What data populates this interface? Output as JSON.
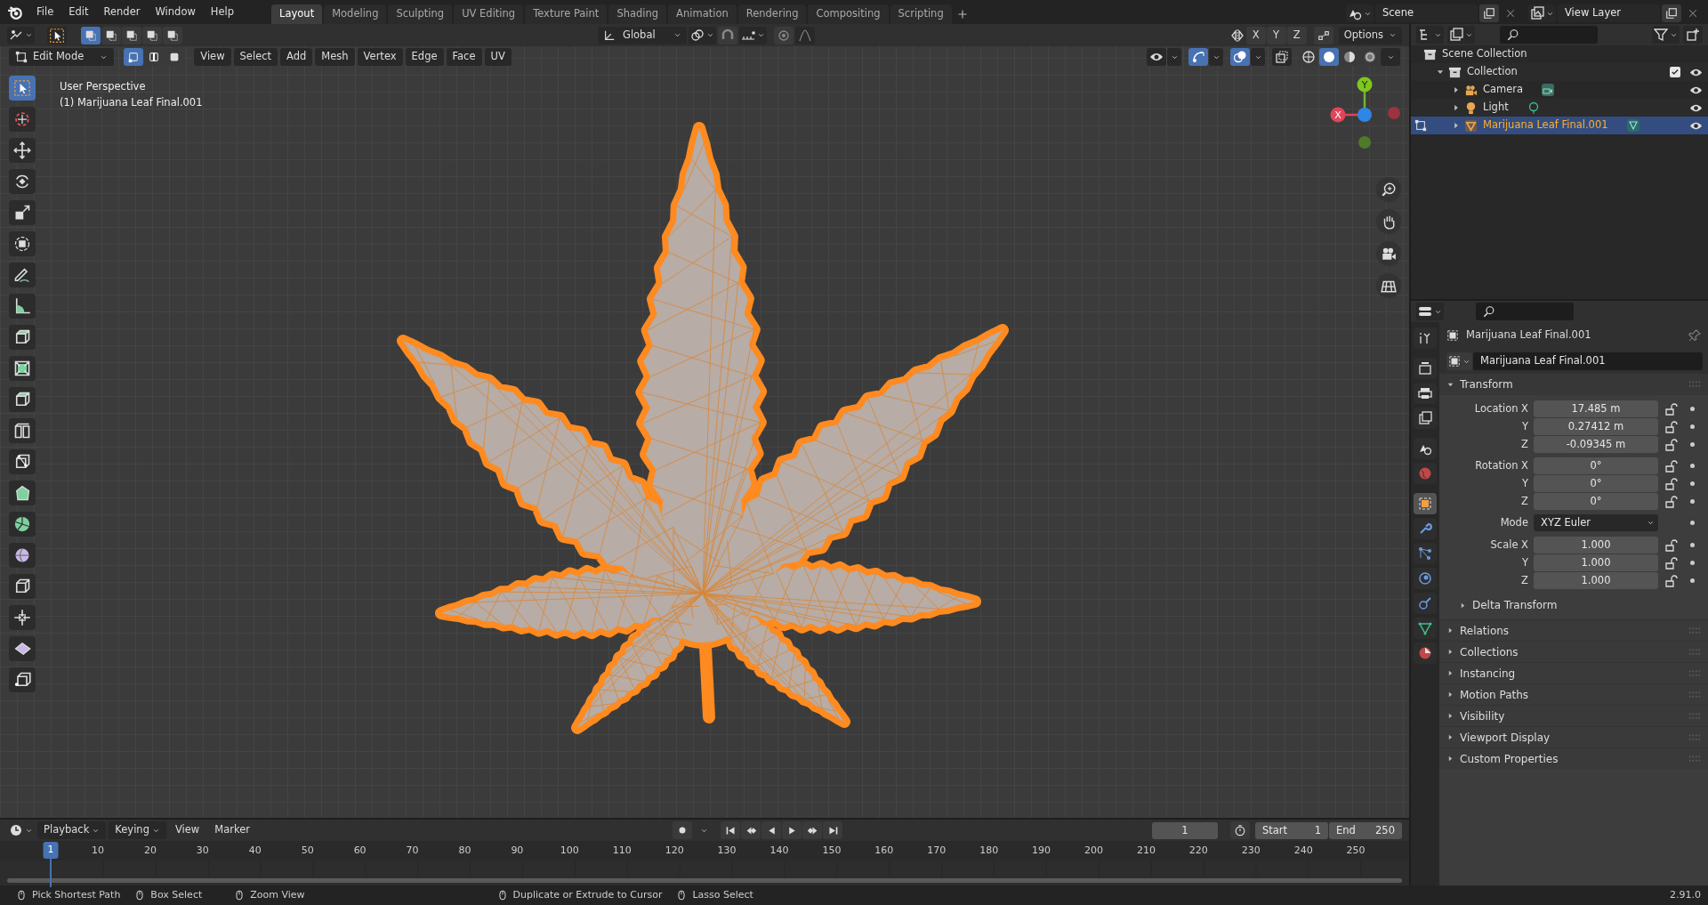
{
  "menu": [
    "File",
    "Edit",
    "Render",
    "Window",
    "Help"
  ],
  "workspaces": [
    {
      "label": "Layout",
      "selected": true
    },
    {
      "label": "Modeling",
      "selected": false
    },
    {
      "label": "Sculpting",
      "selected": false
    },
    {
      "label": "UV Editing",
      "selected": false
    },
    {
      "label": "Texture Paint",
      "selected": false
    },
    {
      "label": "Shading",
      "selected": false
    },
    {
      "label": "Animation",
      "selected": false
    },
    {
      "label": "Rendering",
      "selected": false
    },
    {
      "label": "Compositing",
      "selected": false
    },
    {
      "label": "Scripting",
      "selected": false
    }
  ],
  "scene": {
    "name": "Scene"
  },
  "view_layer": {
    "name": "View Layer"
  },
  "tool_header": {
    "orientation": "Global",
    "axes": [
      "X",
      "Y",
      "Z"
    ],
    "options": "Options"
  },
  "viewport_header": {
    "mode": "Edit Mode",
    "menus": [
      "View",
      "Select",
      "Add",
      "Mesh",
      "Vertex",
      "Edge",
      "Face",
      "UV"
    ]
  },
  "toolbar": [
    {
      "selected": true
    },
    {
      "selected": false
    },
    {
      "selected": false
    },
    {
      "selected": false
    },
    {
      "selected": false
    },
    {
      "selected": false
    },
    {
      "selected": false
    },
    {
      "selected": false
    },
    {
      "selected": false
    },
    {
      "selected": false
    },
    {
      "selected": false
    },
    {
      "selected": false
    },
    {
      "selected": false
    },
    {
      "selected": false
    },
    {
      "selected": false
    },
    {
      "selected": false
    },
    {
      "selected": false
    },
    {
      "selected": false
    },
    {
      "selected": false
    },
    {
      "selected": false
    }
  ],
  "viewport": {
    "view_name": "User Perspective",
    "object_label": "(1) Marijuana Leaf Final.001",
    "gizmo_labels": [
      "X",
      "Y"
    ]
  },
  "outliner": {
    "items": [
      {
        "label": "Scene Collection",
        "kind": "scene",
        "selected": false,
        "children": [
          {
            "label": "Collection",
            "kind": "collection",
            "selected": false,
            "expanded": true,
            "checked": true,
            "children": [
              {
                "label": "Camera",
                "kind": "camera",
                "selected": false,
                "expanded": false
              },
              {
                "label": "Light",
                "kind": "light",
                "selected": false,
                "expanded": false
              },
              {
                "label": "Marijuana Leaf Final.001",
                "kind": "mesh",
                "selected": true,
                "expanded": false
              }
            ]
          }
        ]
      }
    ]
  },
  "properties": {
    "tabs": [
      {
        "selected": false
      },
      {
        "selected": false
      },
      {
        "selected": false
      },
      {
        "selected": false
      },
      {
        "selected": false
      },
      {
        "selected": false
      },
      {
        "selected": true
      },
      {
        "selected": false
      },
      {
        "selected": false
      },
      {
        "selected": false
      },
      {
        "selected": false
      },
      {
        "selected": false
      },
      {
        "selected": false
      }
    ],
    "object_name": "Marijuana Leaf Final.001",
    "data_name": "Marijuana Leaf Final.001",
    "transform": {
      "title": "Transform",
      "expanded": true,
      "location": [
        {
          "label": "Location X",
          "value": "17.485 m"
        },
        {
          "label": "Y",
          "value": "0.27412 m"
        },
        {
          "label": "Z",
          "value": "-0.09345 m"
        }
      ],
      "rotation": [
        {
          "label": "Rotation X",
          "value": "0°"
        },
        {
          "label": "Y",
          "value": "0°"
        },
        {
          "label": "Z",
          "value": "0°"
        }
      ],
      "mode_label": "Mode",
      "mode": "XYZ Euler",
      "scale": [
        {
          "label": "Scale X",
          "value": "1.000"
        },
        {
          "label": "Y",
          "value": "1.000"
        },
        {
          "label": "Z",
          "value": "1.000"
        }
      ]
    },
    "delta_transform": {
      "title": "Delta Transform",
      "expanded": false
    },
    "panels": [
      {
        "title": "Relations",
        "expanded": false
      },
      {
        "title": "Collections",
        "expanded": false
      },
      {
        "title": "Instancing",
        "expanded": false
      },
      {
        "title": "Motion Paths",
        "expanded": false
      },
      {
        "title": "Visibility",
        "expanded": false
      },
      {
        "title": "Viewport Display",
        "expanded": false
      },
      {
        "title": "Custom Properties",
        "expanded": false
      }
    ]
  },
  "timeline": {
    "menus": [
      {
        "label": "Playback",
        "dropdown": true
      },
      {
        "label": "Keying",
        "dropdown": true
      },
      {
        "label": "View",
        "dropdown": false
      },
      {
        "label": "Marker",
        "dropdown": false
      }
    ],
    "current_frame": "1",
    "start_label": "Start",
    "start": "1",
    "end_label": "End",
    "end": "250",
    "playhead": "1",
    "ticks": [
      "10",
      "20",
      "30",
      "40",
      "50",
      "60",
      "70",
      "80",
      "90",
      "100",
      "110",
      "120",
      "130",
      "140",
      "150",
      "160",
      "170",
      "180",
      "190",
      "200",
      "210",
      "220",
      "230",
      "240",
      "250"
    ]
  },
  "status_bar": {
    "hints": [
      "Pick Shortest Path",
      "Box Select",
      "Zoom View",
      "Duplicate or Extrude to Cursor",
      "Lasso Select"
    ],
    "version": "2.91.0"
  }
}
